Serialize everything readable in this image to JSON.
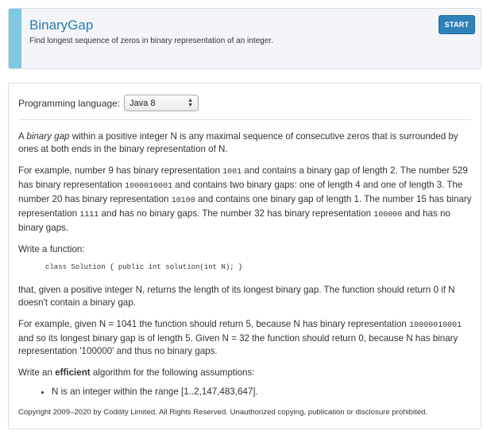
{
  "header": {
    "title": "BinaryGap",
    "subtitle": "Find longest sequence of zeros in binary representation of an integer.",
    "start_label": "START"
  },
  "language": {
    "label": "Programming language:",
    "selected": "Java 8"
  },
  "task": {
    "p1_italic": "binary gap",
    "p1_pre": "A ",
    "p1_post": " within a positive integer N is any maximal sequence of consecutive zeros that is surrounded by ones at both ends in the binary representation of N.",
    "p2_a": "For example, number 9 has binary representation ",
    "p2_c1": "1001",
    "p2_b": " and contains a binary gap of length 2. The number 529 has binary representation ",
    "p2_c2": "1000010001",
    "p2_c": " and contains two binary gaps: one of length 4 and one of length 3. The number 20 has binary representation ",
    "p2_c3": "10100",
    "p2_d": " and contains one binary gap of length 1. The number 15 has binary representation ",
    "p2_c4": "1111",
    "p2_e": " and has no binary gaps. The number 32 has binary representation ",
    "p2_c5": "100000",
    "p2_f": " and has no binary gaps.",
    "write_fn": "Write a function:",
    "code": "class Solution { public int solution(int N); }",
    "p3": "that, given a positive integer N, returns the length of its longest binary gap. The function should return 0 if N doesn't contain a binary gap.",
    "p4_a": "For example, given N = 1041 the function should return 5, because N has binary representation ",
    "p4_c1": "10000010001",
    "p4_b": " and so its longest binary gap is of length 5. Given N = 32 the function should return 0, because N has binary representation '100000' and thus no binary gaps.",
    "p5_pre": "Write an ",
    "p5_bold": "efficient",
    "p5_post": " algorithm for the following assumptions:",
    "assumption_1": "N is an integer within the range [1..2,147,483,647].",
    "copyright": "Copyright 2009–2020 by Codility Limited. All Rights Reserved. Unauthorized copying, publication or disclosure prohibited."
  }
}
